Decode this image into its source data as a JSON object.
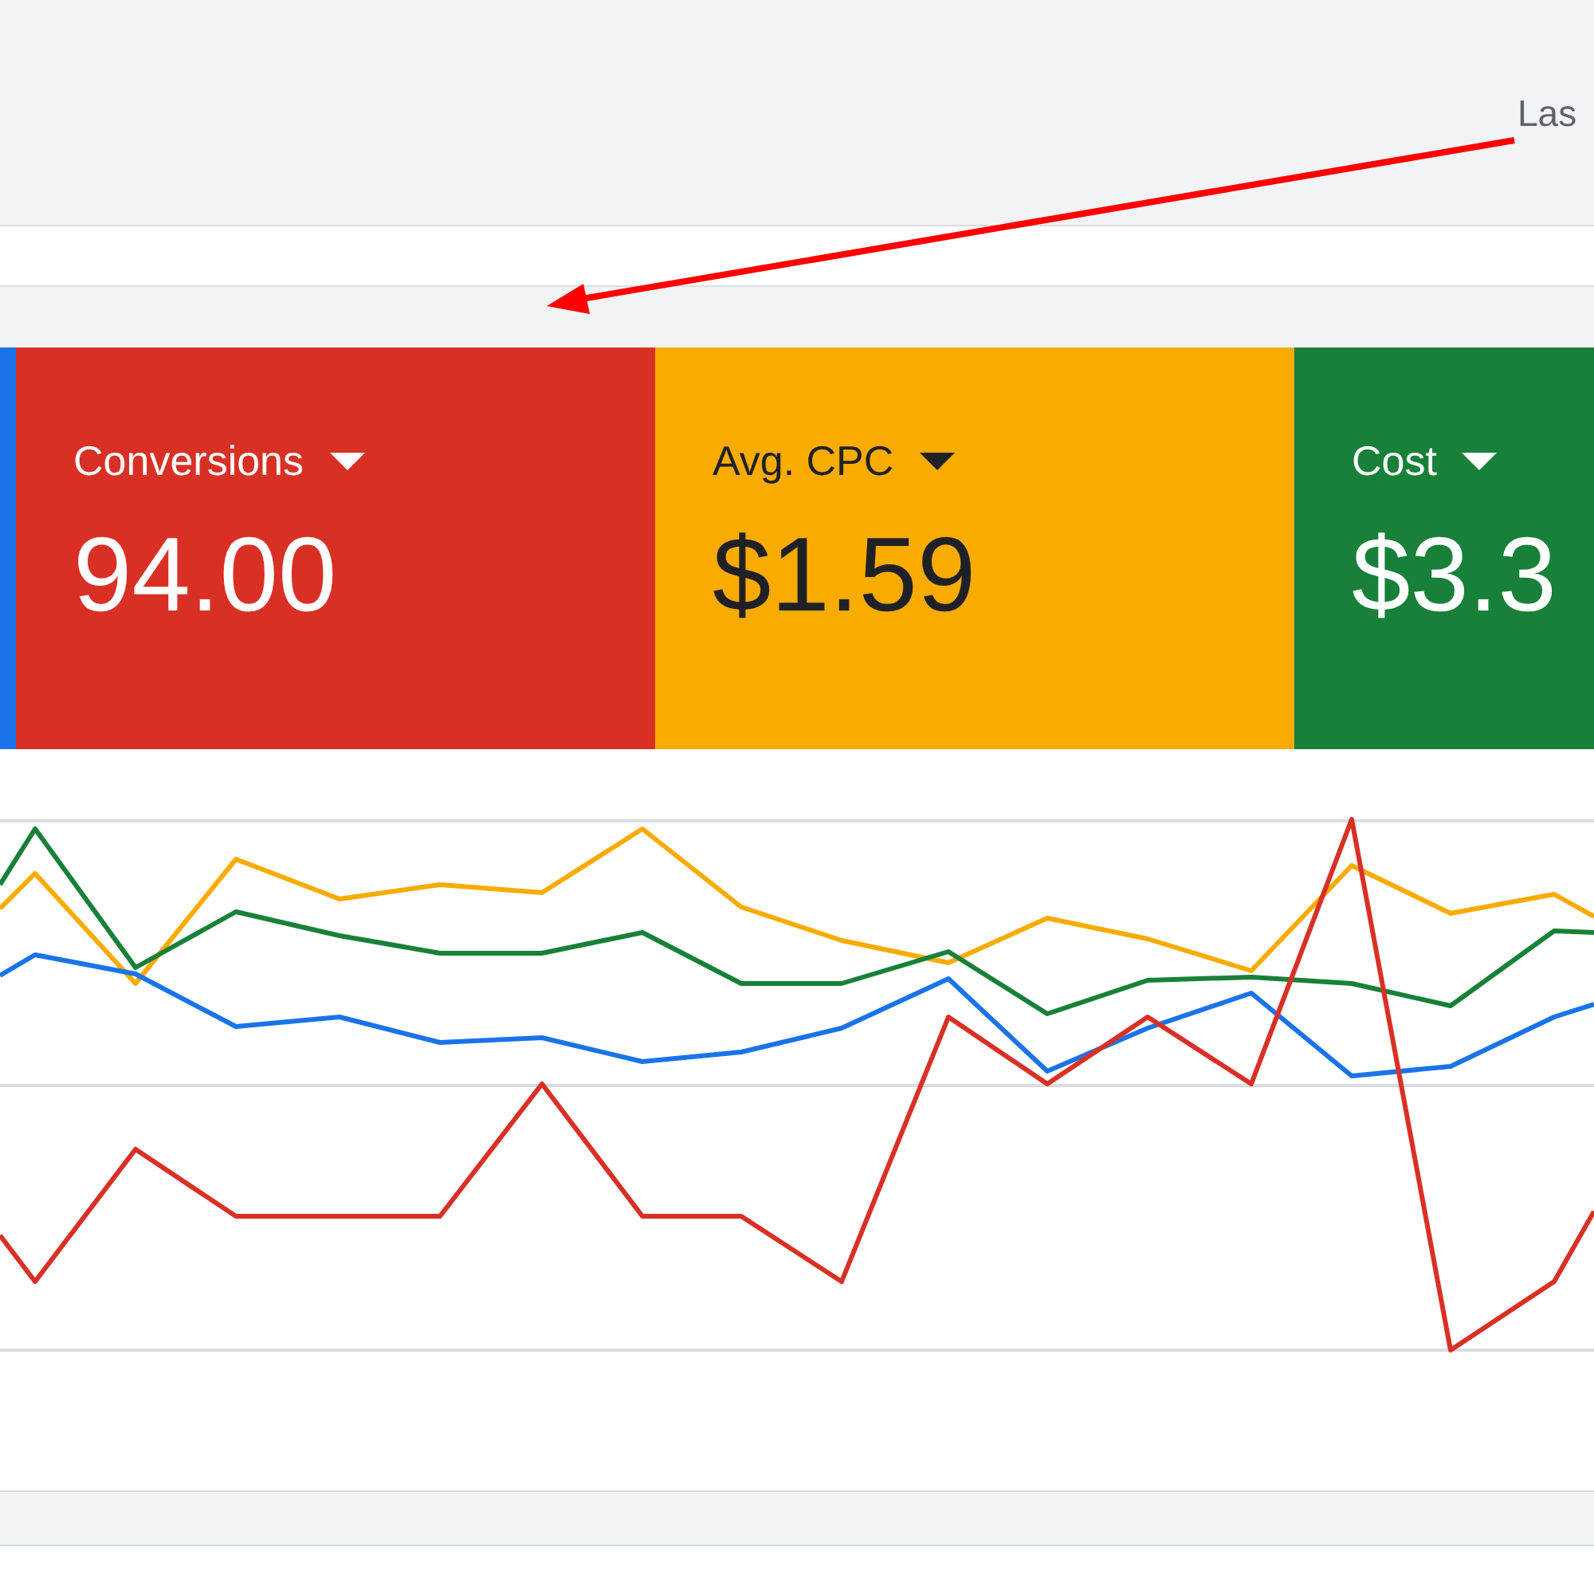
{
  "header": {
    "date_range_label": "Las"
  },
  "metric_cards": [
    {
      "color": "#1a73e8"
    },
    {
      "label": "Conversions",
      "value": "94.00",
      "color": "#d93025"
    },
    {
      "label": "Avg. CPC",
      "value": "$1.59",
      "color": "#f9ab00"
    },
    {
      "label": "Cost",
      "value": "$3.3",
      "color": "#188038"
    }
  ]
}
